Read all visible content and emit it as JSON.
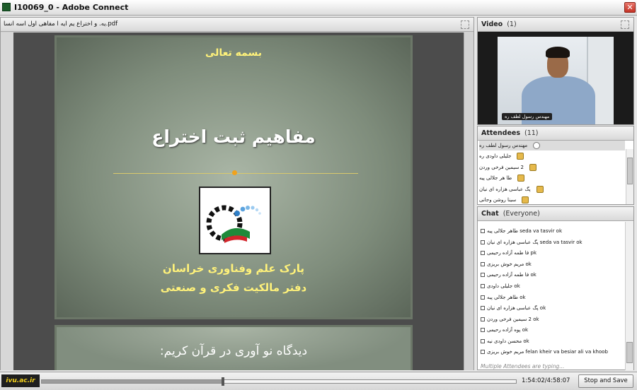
{
  "window": {
    "title": "I10069_0 - Adobe Connect",
    "close_glyph": "✕"
  },
  "share_pod": {
    "document_name": "یه. و اختراع یم ایه ا مفاهی اول اسه انسا.pdf"
  },
  "slide": {
    "basmala": "بسمه تعالی",
    "title": "مفاهیم ثبت اختراع",
    "org_line1": "پارک علم وفناوری خراسان",
    "org_line2": "دفتر مالکیت فکری و صنعتی",
    "next_slide_text": "دیدگاه نو آوری در قرآن کریم:"
  },
  "video_pod": {
    "label": "Video",
    "count": "(1)",
    "presenter_name": "مهندس رسول لطف ره"
  },
  "attendees_pod": {
    "label": "Attendees",
    "count": "(11)",
    "items": [
      {
        "name": "مهندس رسول لطف ره",
        "icon": "phone-icon"
      },
      {
        "name": "جلیلی داودی ره",
        "icon": "user-icon"
      },
      {
        "name": "2 سیمین فرخی وردن",
        "icon": "user-icon"
      },
      {
        "name": "طا هر جلالی پیه",
        "icon": "user-icon"
      },
      {
        "name": "پگ عباسی هزاره ای نیان",
        "icon": "user-icon"
      },
      {
        "name": "سینا روشن وجانی",
        "icon": "user-icon"
      }
    ]
  },
  "chat_pod": {
    "label": "Chat",
    "scope": "(Everyone)",
    "messages": [
      {
        "user": "طاهر جلالی پیه",
        "text": "seda va tasvir ok"
      },
      {
        "user": "پگ عباسی هزاره ای نیان",
        "text": "seda va tasvir  ok"
      },
      {
        "user": "فا طمه آزاده رحیمی",
        "text": "pk"
      },
      {
        "user": "مریم خوش بریزی",
        "text": "ok"
      },
      {
        "user": "فا طمه آزاده رحیمی",
        "text": "ok"
      },
      {
        "user": "جلیلی داودی",
        "text": "ok"
      },
      {
        "user": "طاهر جلالی پیه",
        "text": "ok"
      },
      {
        "user": "پگ عباسی هزاره ای نیان",
        "text": "ok"
      },
      {
        "user": "2 سیمین فرخی وردن",
        "text": "ok"
      },
      {
        "user": "پوه آزاده رحیمی",
        "text": "ok"
      },
      {
        "user": "محسن داودی نیه",
        "text": "ok"
      },
      {
        "user": "مریم خوش بریزی",
        "text": "felan kheir va besiar ali va khoob"
      }
    ],
    "typing_status": "Multiple Attendees are typing..."
  },
  "playback": {
    "brand": "ivu.ac.ir",
    "time": "1:54:02/4:58:07",
    "progress_fraction": 0.382,
    "stop_button": "Stop and Save"
  }
}
